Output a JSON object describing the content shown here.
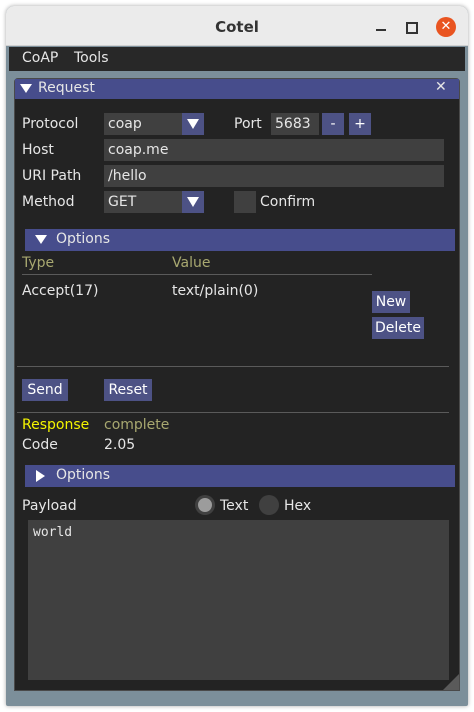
{
  "window": {
    "title": "Cotel",
    "close_glyph": "✕"
  },
  "menubar": {
    "items": [
      "CoAP",
      "Tools"
    ]
  },
  "request_panel": {
    "title": "Request",
    "close_glyph": "✕",
    "protocol_label": "Protocol",
    "protocol_value": "coap",
    "port_label": "Port",
    "port_value": "5683",
    "port_minus": "-",
    "port_plus": "+",
    "host_label": "Host",
    "host_value": "coap.me",
    "uri_label": "URI Path",
    "uri_value": "/hello",
    "method_label": "Method",
    "method_value": "GET",
    "confirm_label": "Confirm",
    "confirm_checked": false
  },
  "request_options": {
    "header": "Options",
    "col_type": "Type",
    "col_value": "Value",
    "rows": [
      {
        "type": "Accept(17)",
        "value": "text/plain(0)"
      }
    ],
    "new_label": "New",
    "delete_label": "Delete"
  },
  "actions": {
    "send_label": "Send",
    "reset_label": "Reset"
  },
  "response": {
    "label": "Response",
    "status": "complete",
    "code_label": "Code",
    "code_value": "2.05",
    "options_header": "Options",
    "payload_label": "Payload",
    "format_text_label": "Text",
    "format_hex_label": "Hex",
    "format_selected": "Text",
    "payload_text": "world"
  },
  "colors": {
    "accent": "#474d8c",
    "button": "#4d5285",
    "response_label": "#f5f500",
    "status_text": "#a8a870",
    "column_header": "#a8a870"
  }
}
